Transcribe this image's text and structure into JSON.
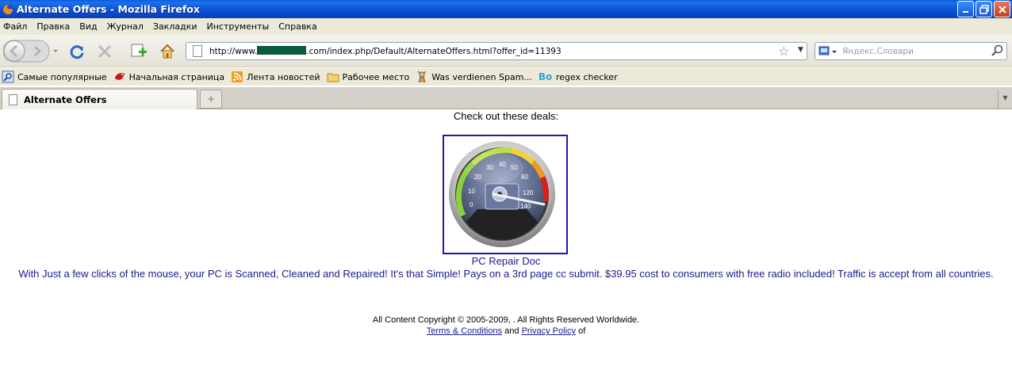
{
  "window": {
    "title": "Alternate Offers - Mozilla Firefox"
  },
  "menu": [
    "Файл",
    "Правка",
    "Вид",
    "Журнал",
    "Закладки",
    "Инструменты",
    "Справка"
  ],
  "navbar": {
    "url_prefix": "http://www.",
    "url_suffix": ".com/index.php/Default/AlternateOffers.html?offer_id=11393",
    "search_placeholder": "Яндекс.Словари"
  },
  "bookmarks": [
    {
      "label": "Самые популярные",
      "icon": "search-icon"
    },
    {
      "label": "Начальная страница",
      "icon": "bird-icon"
    },
    {
      "label": "Лента новостей",
      "icon": "rss-icon"
    },
    {
      "label": "Рабочее место",
      "icon": "folder-icon"
    },
    {
      "label": "Was verdienen Spam...",
      "icon": "puppet-icon"
    },
    {
      "label": "regex checker",
      "icon": "bo-icon"
    }
  ],
  "tabs": [
    {
      "label": "Alternate Offers"
    }
  ],
  "page": {
    "heading": "Check out these deals:",
    "offer_name": "PC Repair Doc",
    "offer_description": "With Just a few clicks of the mouse, your PC is Scanned, Cleaned and Repaired! It's that Simple! Pays on a 3rd page cc submit. $39.95 cost to consumers with free radio included! Traffic is accept from all countries.",
    "copyright": "All Content Copyright © 2005-2009, . All Rights Reserved Worldwide.",
    "terms_label": "Terms & Conditions",
    "and_text": "and",
    "privacy_label": "Privacy Policy",
    "of_text": "of"
  },
  "gauge": {
    "ticks": [
      "0",
      "10",
      "20",
      "30",
      "40",
      "50",
      "80",
      "120",
      "140"
    ]
  },
  "colors": {
    "link": "#1a1a8c",
    "img_border": "#1a1ab0",
    "titlebar": "#0b54d8"
  }
}
